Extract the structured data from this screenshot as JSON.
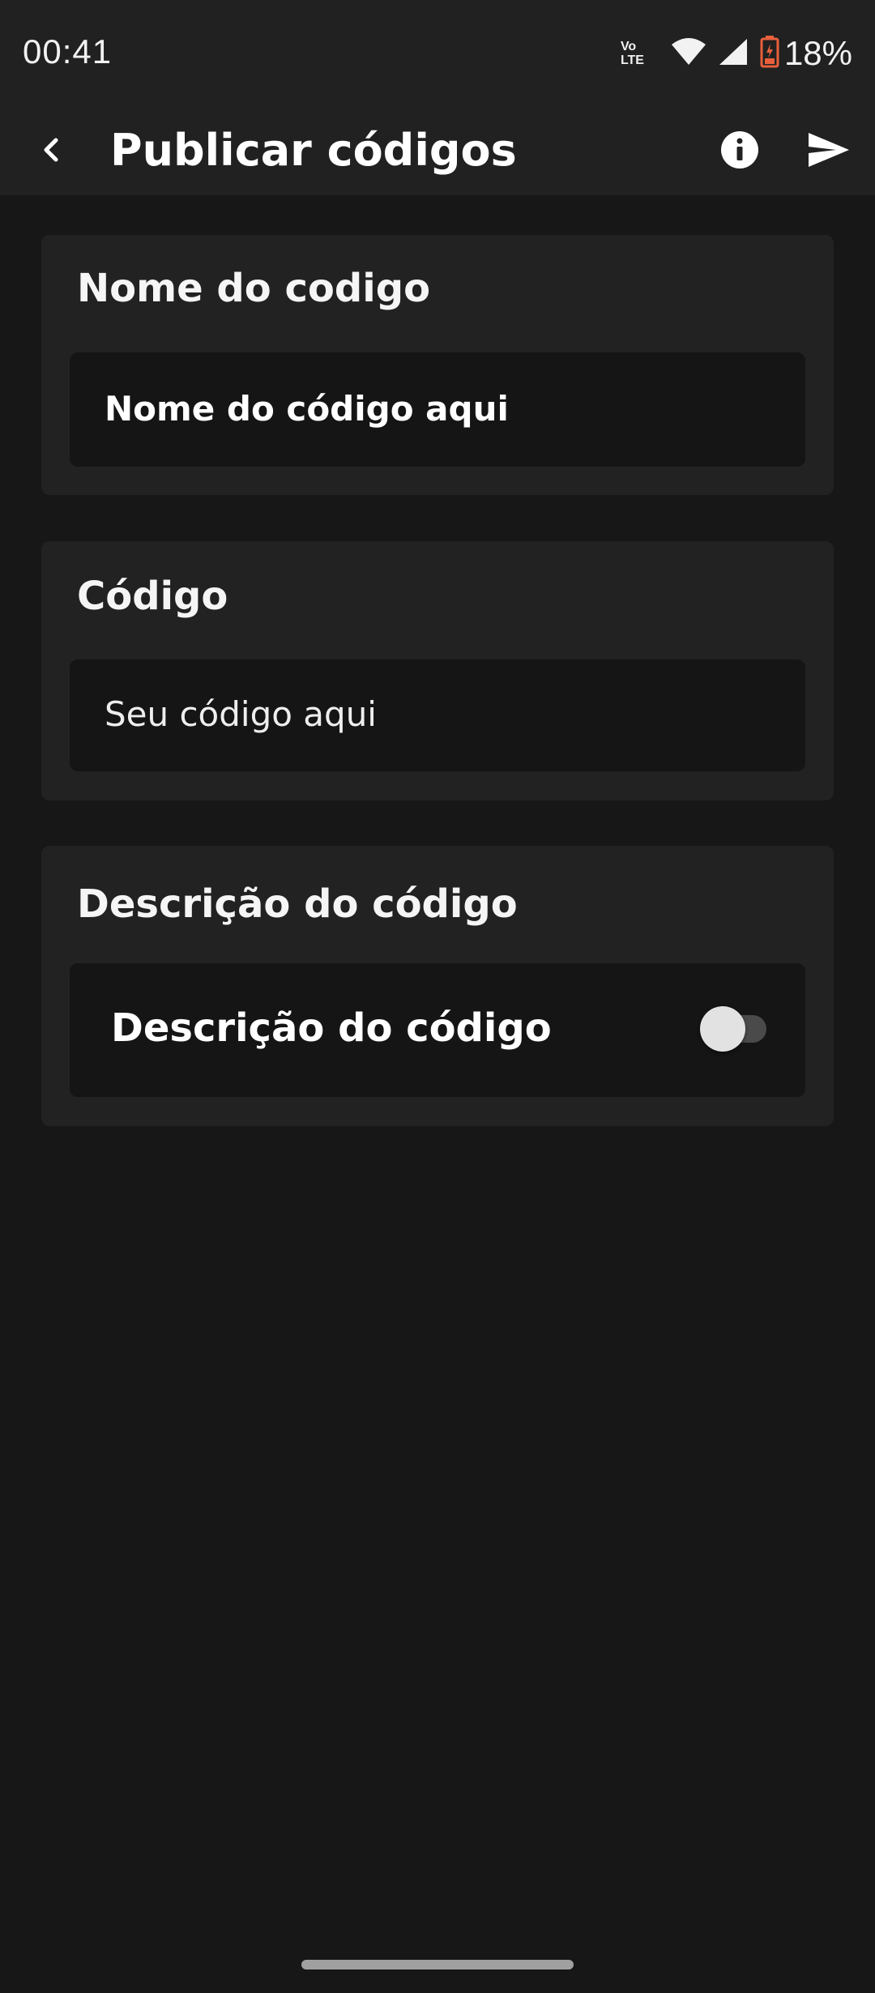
{
  "status_bar": {
    "time": "00:41",
    "volte_top": "Vo",
    "volte_bottom": "LTE",
    "battery_percent": "18%",
    "battery_color": "#e8603c"
  },
  "app_bar": {
    "title": "Publicar códigos",
    "back_icon": "chevron-left-icon",
    "info_icon": "info-icon",
    "send_icon": "send-icon"
  },
  "form": {
    "name_section": {
      "label": "Nome do codigo",
      "value": "Nome do código aqui"
    },
    "code_section": {
      "label": "Código",
      "placeholder": "Seu código aqui"
    },
    "description_section": {
      "label": "Descrição do código",
      "toggle_label": "Descrição do código",
      "toggle_on": false
    }
  }
}
